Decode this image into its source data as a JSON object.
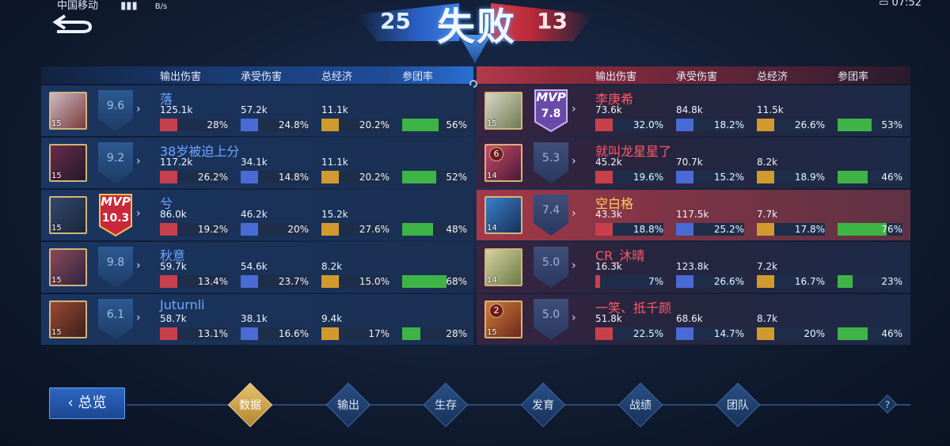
{
  "status_bar": {
    "carrier": "中国移动",
    "net_unit": "B/s",
    "time": "07:52"
  },
  "header": {
    "result": "失败",
    "blue_score": "25",
    "red_score": "13"
  },
  "columns": [
    "输出伤害",
    "承受伤害",
    "总经济",
    "参团率"
  ],
  "colors": {
    "damage": "#c8404c",
    "taken": "#4a6ad6",
    "gold": "#d19a2e",
    "team": "#3fb446",
    "blue_name": "#6ea7ff",
    "red_name": "#ff5a66",
    "self_name": "#ffcf5e"
  },
  "blue_team": [
    {
      "name": "落",
      "level": "15",
      "score": "9.6",
      "mvp": false,
      "badge": "",
      "damage": "125.1k",
      "damage_pct": "28%",
      "taken": "57.2k",
      "taken_pct": "24.8%",
      "gold": "11.1k",
      "gold_pct": "20.2%",
      "team_pct": "56%",
      "team_value": 0.56
    },
    {
      "name": "38岁被迫上分",
      "level": "15",
      "score": "9.2",
      "mvp": false,
      "badge": "",
      "damage": "117.2k",
      "damage_pct": "26.2%",
      "taken": "34.1k",
      "taken_pct": "14.8%",
      "gold": "11.1k",
      "gold_pct": "20.2%",
      "team_pct": "52%",
      "team_value": 0.52
    },
    {
      "name": "兮",
      "level": "15",
      "score": "10.3",
      "mvp": true,
      "mvp_label": "MVP",
      "badge": "",
      "damage": "86.0k",
      "damage_pct": "19.2%",
      "taken": "46.2k",
      "taken_pct": "20%",
      "gold": "15.2k",
      "gold_pct": "27.6%",
      "team_pct": "48%",
      "team_value": 0.48
    },
    {
      "name": "秋意",
      "level": "15",
      "score": "9.8",
      "mvp": false,
      "badge": "",
      "damage": "59.7k",
      "damage_pct": "13.4%",
      "taken": "54.6k",
      "taken_pct": "23.7%",
      "gold": "8.2k",
      "gold_pct": "15.0%",
      "team_pct": "68%",
      "team_value": 0.68
    },
    {
      "name": "Juturnli",
      "level": "15",
      "score": "6.1",
      "mvp": false,
      "badge": "",
      "damage": "58.7k",
      "damage_pct": "13.1%",
      "taken": "38.1k",
      "taken_pct": "16.6%",
      "gold": "9.4k",
      "gold_pct": "17%",
      "team_pct": "28%",
      "team_value": 0.28
    }
  ],
  "red_team": [
    {
      "name": "李庚希",
      "level": "15",
      "score": "7.8",
      "mvp": true,
      "mvp_label": "MVP",
      "badge": "",
      "highlight": false,
      "name_style": "red",
      "damage": "73.6k",
      "damage_pct": "32.0%",
      "taken": "84.8k",
      "taken_pct": "18.2%",
      "gold": "11.5k",
      "gold_pct": "26.6%",
      "team_pct": "53%",
      "team_value": 0.53
    },
    {
      "name": "就叫龙星星了",
      "level": "14",
      "score": "5.3",
      "mvp": false,
      "badge": "6",
      "highlight": false,
      "name_style": "red",
      "damage": "45.2k",
      "damage_pct": "19.6%",
      "taken": "70.7k",
      "taken_pct": "15.2%",
      "gold": "8.2k",
      "gold_pct": "18.9%",
      "team_pct": "46%",
      "team_value": 0.46
    },
    {
      "name": "空白格",
      "level": "14",
      "score": "7.4",
      "mvp": false,
      "badge": "",
      "highlight": true,
      "name_style": "self",
      "damage": "43.3k",
      "damage_pct": "18.8%",
      "taken": "117.5k",
      "taken_pct": "25.2%",
      "gold": "7.7k",
      "gold_pct": "17.8%",
      "team_pct": "76%",
      "team_value": 0.76
    },
    {
      "name": "CR_沐晴",
      "level": "14",
      "score": "5.0",
      "mvp": false,
      "badge": "",
      "highlight": false,
      "name_style": "red",
      "damage": "16.3k",
      "damage_pct": "7%",
      "taken": "123.8k",
      "taken_pct": "26.6%",
      "gold": "7.2k",
      "gold_pct": "16.7%",
      "team_pct": "23%",
      "team_value": 0.23
    },
    {
      "name": "一笑、抵千颜",
      "level": "15",
      "score": "5.0",
      "mvp": false,
      "badge": "2",
      "highlight": false,
      "name_style": "red",
      "damage": "51.8k",
      "damage_pct": "22.5%",
      "taken": "68.6k",
      "taken_pct": "14.7%",
      "gold": "8.7k",
      "gold_pct": "20%",
      "team_pct": "46%",
      "team_value": 0.46
    }
  ],
  "nav": {
    "overview_label": "总览",
    "tabs": [
      {
        "label": "数据",
        "active": true
      },
      {
        "label": "输出",
        "active": false
      },
      {
        "label": "生存",
        "active": false
      },
      {
        "label": "发育",
        "active": false
      },
      {
        "label": "战绩",
        "active": false
      },
      {
        "label": "团队",
        "active": false
      }
    ],
    "help_icon": "help-icon"
  }
}
